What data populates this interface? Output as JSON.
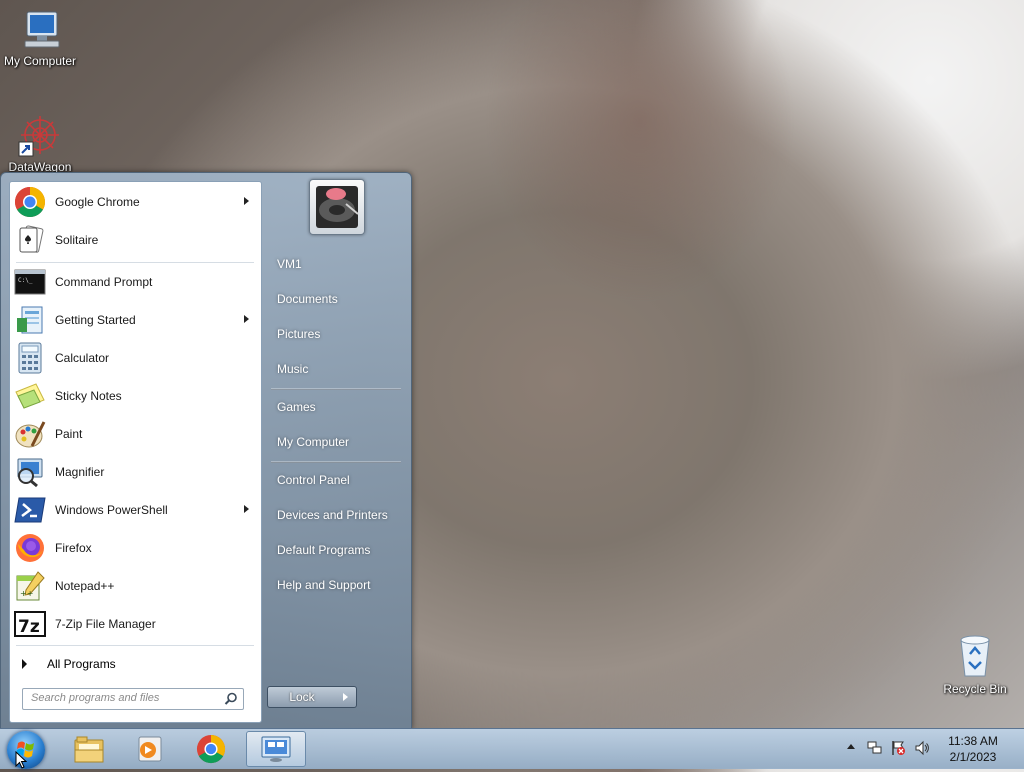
{
  "desktop": {
    "icons": [
      {
        "label": "My Computer"
      },
      {
        "label": "DataWagon"
      },
      {
        "label": "Recycle Bin"
      }
    ]
  },
  "start_menu": {
    "programs": [
      {
        "label": "Google Chrome",
        "has_submenu": true
      },
      {
        "label": "Solitaire",
        "has_submenu": false
      },
      {
        "label": "Command Prompt",
        "has_submenu": false
      },
      {
        "label": "Getting Started",
        "has_submenu": true
      },
      {
        "label": "Calculator",
        "has_submenu": false
      },
      {
        "label": "Sticky Notes",
        "has_submenu": false
      },
      {
        "label": "Paint",
        "has_submenu": false
      },
      {
        "label": "Magnifier",
        "has_submenu": false
      },
      {
        "label": "Windows PowerShell",
        "has_submenu": true
      },
      {
        "label": "Firefox",
        "has_submenu": false
      },
      {
        "label": "Notepad++",
        "has_submenu": false
      },
      {
        "label": "7-Zip File Manager",
        "has_submenu": false
      }
    ],
    "all_programs": "All Programs",
    "search_placeholder": "Search programs and files",
    "right_items": [
      {
        "label": "VM1"
      },
      {
        "label": "Documents"
      },
      {
        "label": "Pictures"
      },
      {
        "label": "Music"
      },
      {
        "label": "Games"
      },
      {
        "label": "My Computer"
      },
      {
        "label": "Control Panel"
      },
      {
        "label": "Devices and Printers"
      },
      {
        "label": "Default Programs"
      },
      {
        "label": "Help and Support"
      }
    ],
    "lock_label": "Lock"
  },
  "taskbar": {
    "pinned": [
      "windows-explorer-icon",
      "media-player-icon",
      "chrome-icon",
      "remote-desktop-icon"
    ],
    "clock_time": "11:38 AM",
    "clock_date": "2/1/2023"
  },
  "colors": {
    "menu_bg": "#8ea6be",
    "taskbar_bg": "#b4c8dc",
    "accent": "#2a7fd0"
  }
}
